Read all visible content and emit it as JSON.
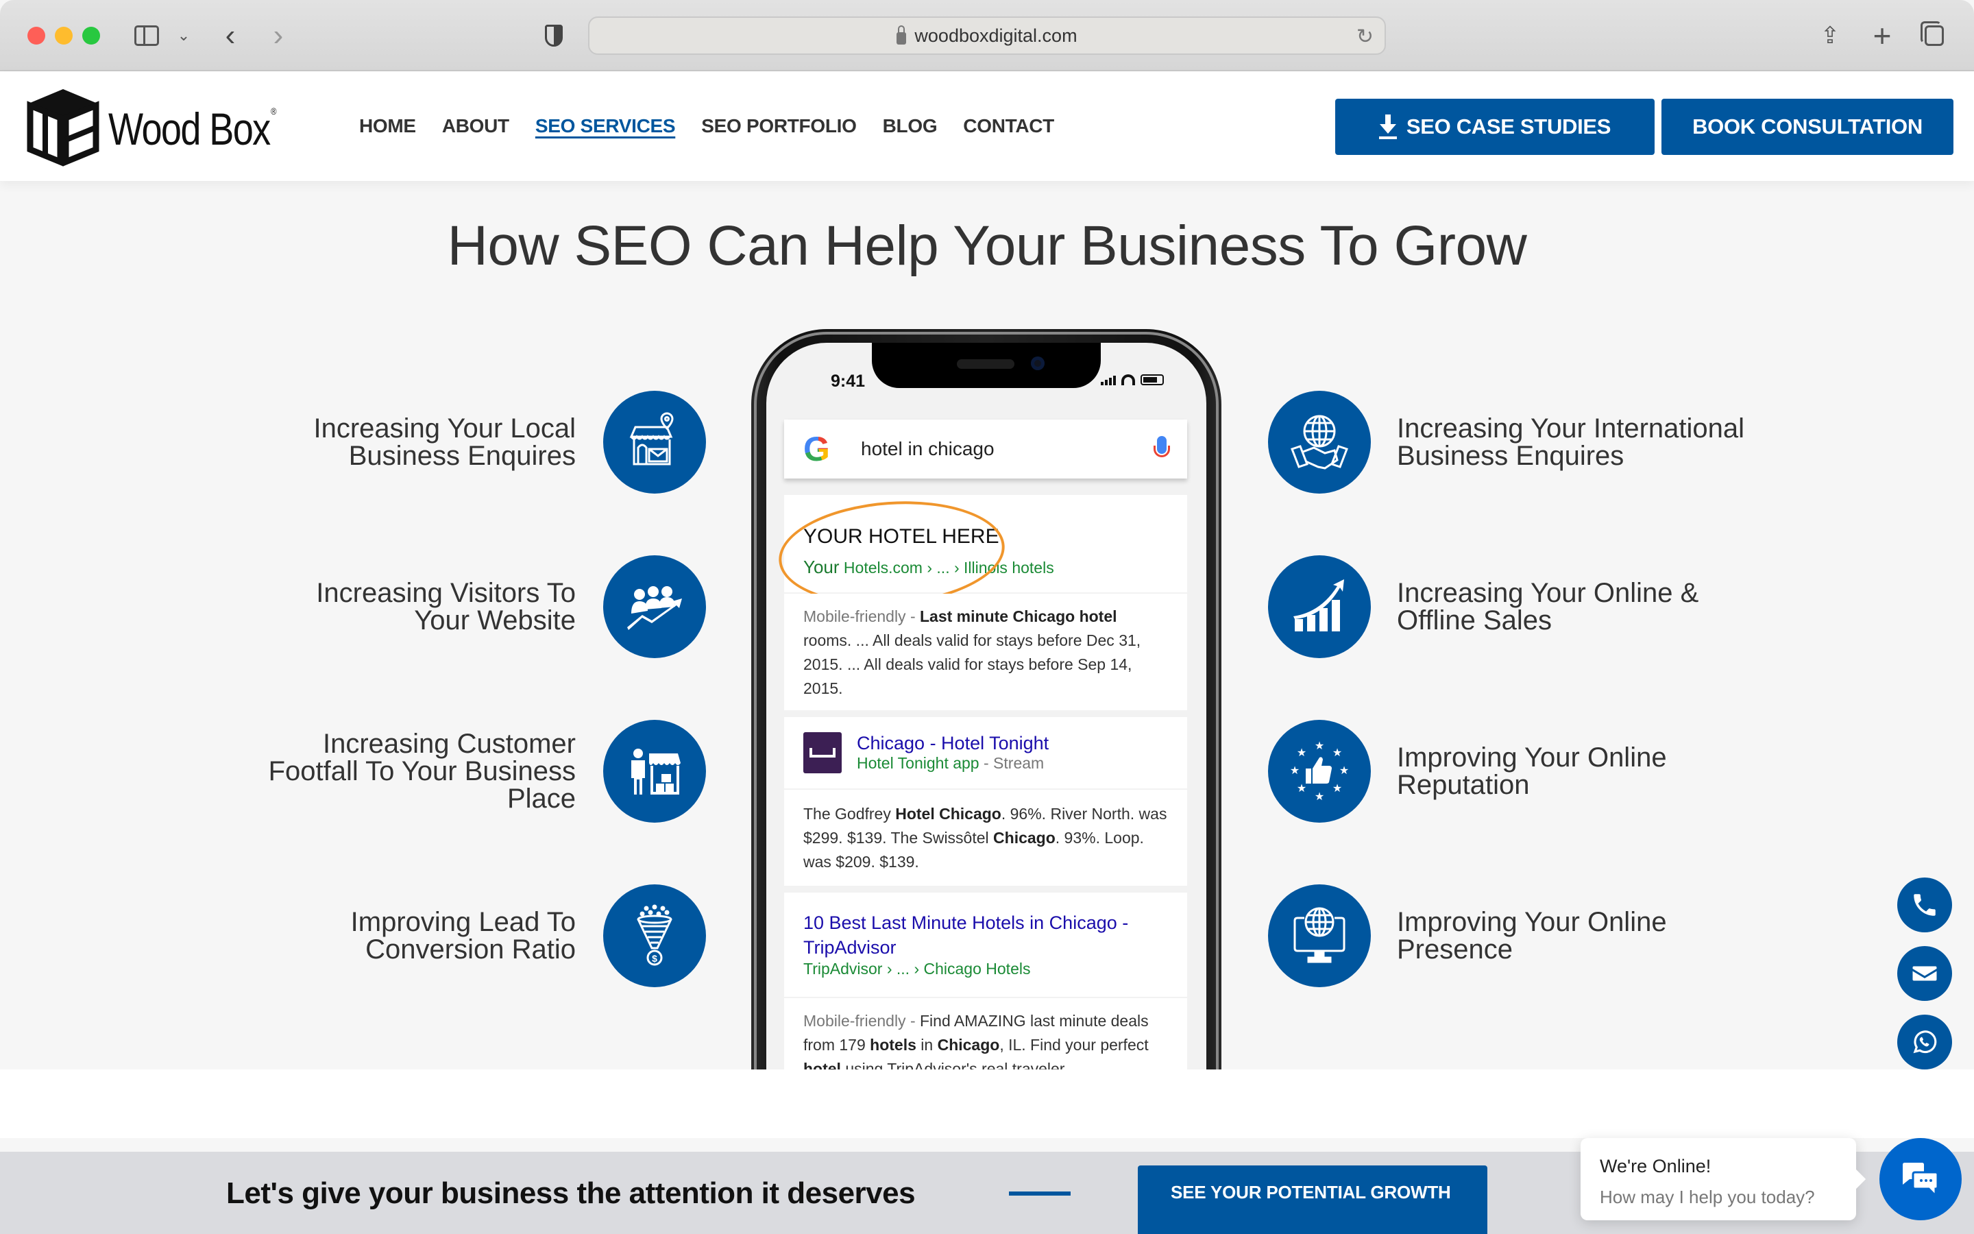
{
  "browser": {
    "url": "woodboxdigital.com"
  },
  "header": {
    "logo_text": "Wood Box",
    "logo_mark": "®",
    "nav": [
      {
        "label": "HOME",
        "active": false
      },
      {
        "label": "ABOUT",
        "active": false
      },
      {
        "label": "SEO SERVICES",
        "active": true
      },
      {
        "label": "SEO PORTFOLIO",
        "active": false
      },
      {
        "label": "BLOG",
        "active": false
      },
      {
        "label": "CONTACT",
        "active": false
      }
    ],
    "case_studies_label": "SEO CASE STUDIES",
    "book_label": "BOOK CONSULTATION"
  },
  "colors": {
    "brand_blue": "#00569e",
    "chat_blue": "#0066cc",
    "highlight_orange": "#f0962c"
  },
  "main": {
    "title": "How SEO Can Help Your Business To Grow",
    "left_features": [
      {
        "icon": "local-store-icon",
        "lines": [
          "Increasing Your Local",
          "Business Enquires"
        ]
      },
      {
        "icon": "visitors-growth-icon",
        "lines": [
          "Increasing Visitors To",
          "Your Website"
        ]
      },
      {
        "icon": "customer-footfall-icon",
        "lines": [
          "Increasing Customer",
          "Footfall To Your Business",
          "Place"
        ]
      },
      {
        "icon": "conversion-funnel-icon",
        "lines": [
          "Improving Lead To",
          "Conversion Ratio"
        ]
      }
    ],
    "right_features": [
      {
        "icon": "globe-handshake-icon",
        "lines": [
          "Increasing Your International",
          "Business Enquires"
        ]
      },
      {
        "icon": "sales-chart-icon",
        "lines": [
          "Increasing Your Online &",
          "Offline Sales"
        ]
      },
      {
        "icon": "reputation-thumbs-up-icon",
        "lines": [
          "Improving Your Online",
          "Reputation"
        ]
      },
      {
        "icon": "online-presence-monitor-icon",
        "lines": [
          "Improving Your Online",
          "Presence"
        ]
      }
    ]
  },
  "phone": {
    "time": "9:41",
    "search_query": "hotel in chicago",
    "result1": {
      "title": "YOUR HOTEL HERE",
      "url_prefix": "Your",
      "url_rest": " Hotels.com › ... › Illinois hotels",
      "snippet_muted": "Mobile-friendly - ",
      "snippet_bold": "Last minute Chicago hotel",
      "snippet_rest": " rooms. ... All deals valid for stays before Dec 31, 2015. ... All deals valid for stays before Sep 14, 2015."
    },
    "result2": {
      "title": "Chicago - Hotel Tonight",
      "source": "Hotel Tonight app",
      "source_suffix": " - Stream",
      "snippet_a": "The Godfrey ",
      "snippet_b": "Hotel Chicago",
      "snippet_c": ". 96%. River North. was $299. $139. The Swissôtel ",
      "snippet_d": "Chicago",
      "snippet_e": ". 93%. Loop. was $209. $139."
    },
    "result3": {
      "title": "10 Best Last Minute Hotels in Chicago - TripAdvisor",
      "url": "TripAdvisor › ... › Chicago Hotels",
      "snippet_muted": "Mobile-friendly - ",
      "snippet_a": "Find AMAZING last minute deals from 179 ",
      "snippet_b": "hotels",
      "snippet_c": " in ",
      "snippet_d": "Chicago",
      "snippet_e": ", IL. Find your perfect ",
      "snippet_f": "hotel",
      "snippet_g": " using TripAdvisor's real traveler ..."
    }
  },
  "cta": {
    "text": "Let's give your business the attention it deserves",
    "button_label": "SEE YOUR POTENTIAL GROWTH"
  },
  "chat": {
    "title": "We're Online!",
    "subtitle": "How may I help you today?"
  }
}
